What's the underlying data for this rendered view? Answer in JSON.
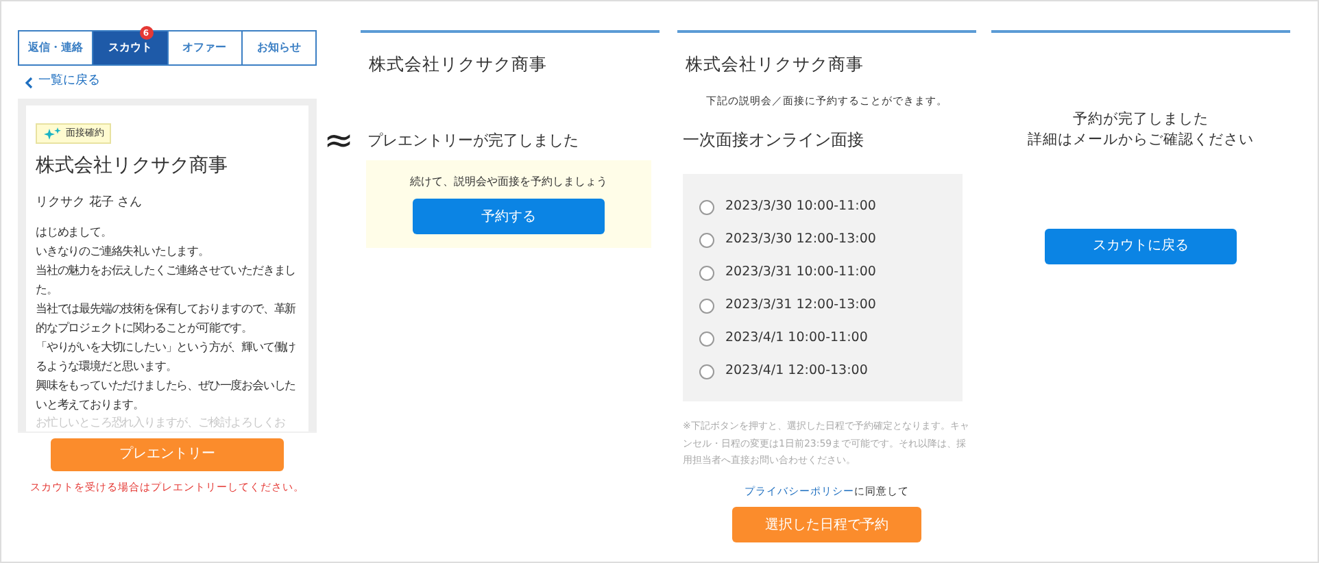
{
  "scout_screen": {
    "tabs": [
      {
        "label": "返信・連絡",
        "selected": false
      },
      {
        "label": "スカウト",
        "selected": true,
        "badge": "6"
      },
      {
        "label": "オファー",
        "selected": false
      },
      {
        "label": "お知らせ",
        "selected": false
      }
    ],
    "back_link": "一覧に戻る",
    "tag": "面接確約",
    "company": "株式会社リクサク商事",
    "recipient": "リクサク 花子 さん",
    "message": [
      "はじめまして。",
      "いきなりのご連絡失礼いたします。",
      "当社の魅力をお伝えしたくご連絡させていただきました。",
      "当社では最先端の技術を保有しておりますので、革新的なプロジェクトに関わることが可能です。",
      "「やりがいを大切にしたい」という方が、輝いて働けるような環境だと思います。",
      "興味をもっていただけましたら、ぜひ一度お会いしたいと考えております。"
    ],
    "faded_message": "お忙しいところ恐れ入りますが、ご検討よろしくお",
    "entry_button": "プレエントリー",
    "note": "スカウトを受ける場合はプレエントリーしてください。"
  },
  "separator": "≈",
  "entry_complete_screen": {
    "company": "株式会社リクサク商事",
    "status": "プレエントリーが完了しました",
    "prompt": "続けて、説明会や面接を予約しましょう",
    "reserve_button": "予約する"
  },
  "reservation_screen": {
    "company": "株式会社リクサク商事",
    "intro": "下記の説明会／面接に予約することができます。",
    "event_title": "一次面接オンライン面接",
    "slots": [
      {
        "label": "2023/3/30 10:00-11:00",
        "selected": false
      },
      {
        "label": "2023/3/30 12:00-13:00",
        "selected": false
      },
      {
        "label": "2023/3/31 10:00-11:00",
        "selected": false
      },
      {
        "label": "2023/3/31 12:00-13:00",
        "selected": false
      },
      {
        "label": "2023/4/1 10:00-11:00",
        "selected": false
      },
      {
        "label": "2023/4/1 12:00-13:00",
        "selected": false
      }
    ],
    "notice": "※下記ボタンを押すと、選択した日程で予約確定となります。キャンセル・日程の変更は1日前23:59まで可能です。それ以降は、採用担当者へ直接お問い合わせください。",
    "policy_link": "プライバシーポリシー",
    "policy_suffix": "に同意して",
    "submit_button": "選択した日程で予約"
  },
  "done_screen": {
    "message_lines": [
      "予約が完了しました",
      "詳細はメールからご確認ください"
    ],
    "back_button": "スカウトに戻る"
  }
}
